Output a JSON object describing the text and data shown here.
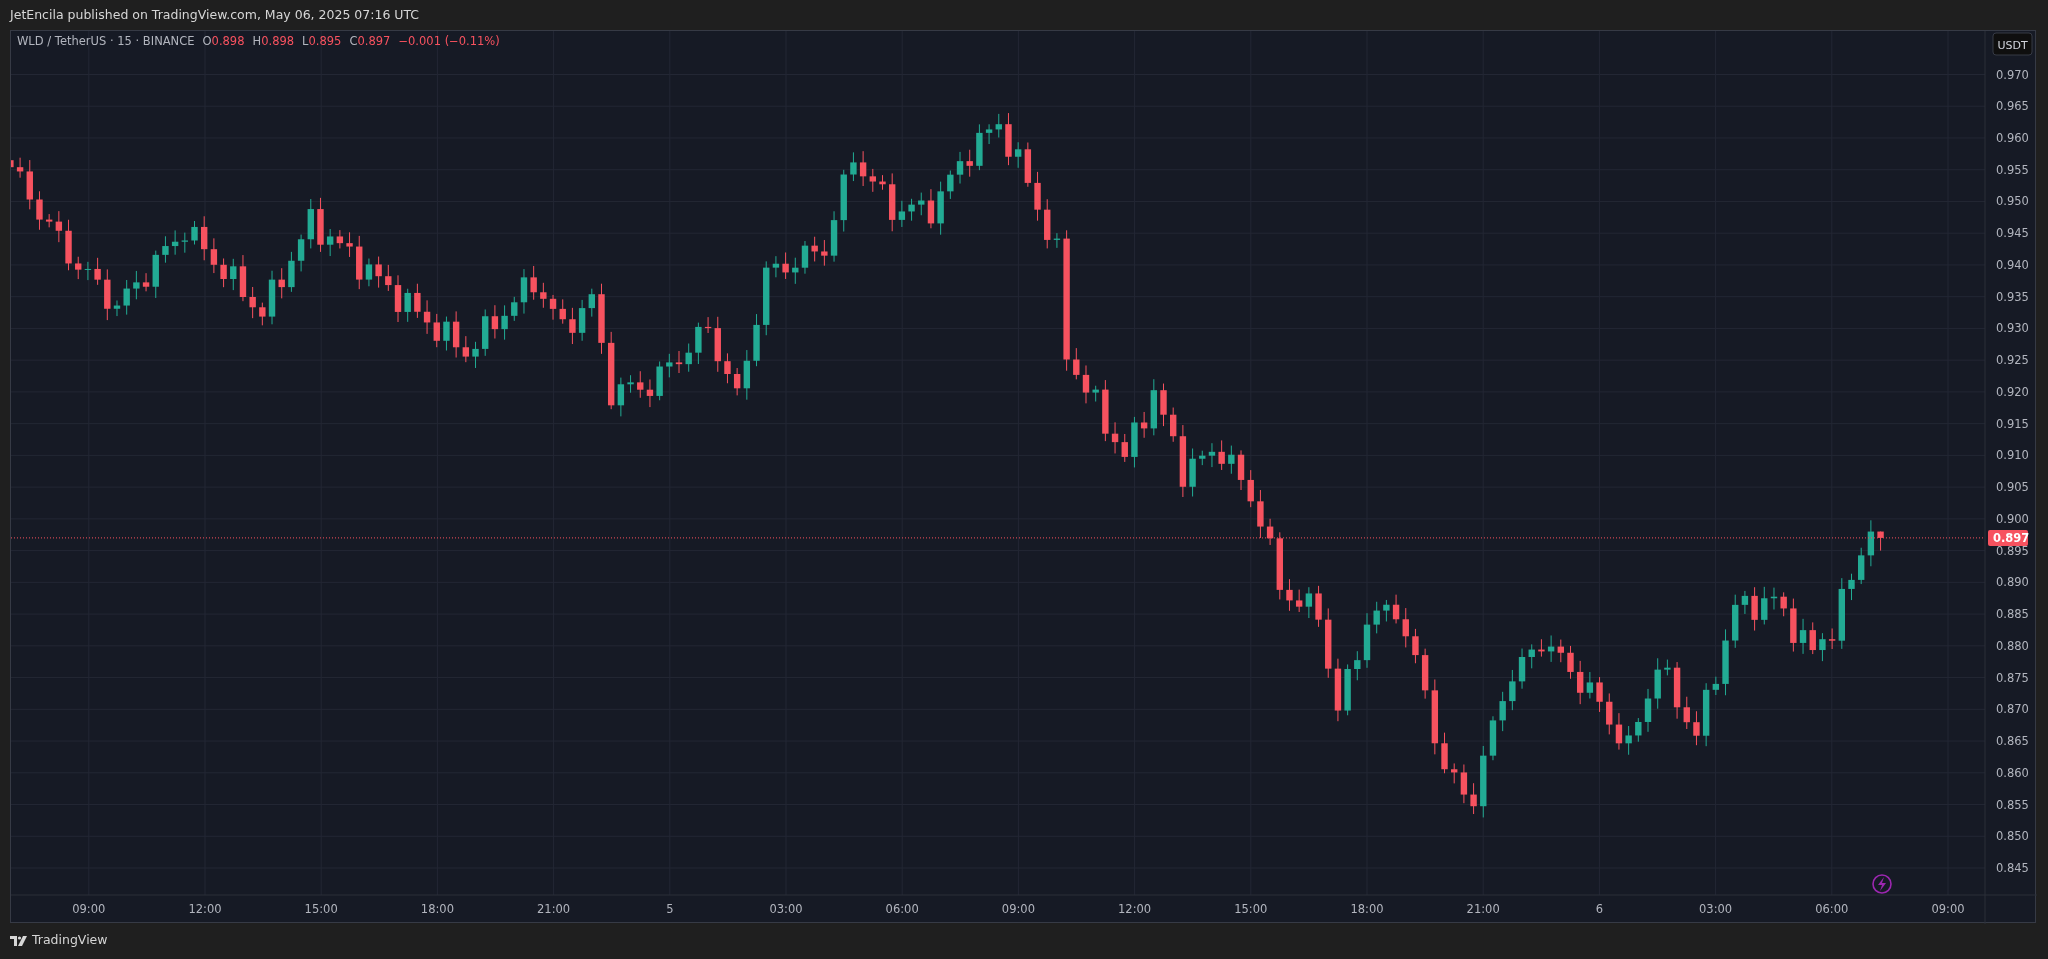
{
  "publish_note": "JetEncila published on TradingView.com, May 06, 2025 07:16 UTC",
  "legend": {
    "symbol": "WLD / TetherUS · 15 · BINANCE",
    "falling": true,
    "fields": [
      {
        "letter": "O",
        "value": "0.898"
      },
      {
        "letter": "H",
        "value": "0.898"
      },
      {
        "letter": "L",
        "value": "0.895"
      },
      {
        "letter": "C",
        "value": "0.897"
      }
    ],
    "change": "−0.001 (−0.11%)"
  },
  "price_axis": {
    "currency": "USDT",
    "ticks": [
      "0.970",
      "0.965",
      "0.960",
      "0.955",
      "0.950",
      "0.945",
      "0.940",
      "0.935",
      "0.930",
      "0.925",
      "0.920",
      "0.915",
      "0.910",
      "0.905",
      "0.900",
      "0.895",
      "0.890",
      "0.885",
      "0.880",
      "0.875",
      "0.870",
      "0.865",
      "0.860",
      "0.855",
      "0.850",
      "0.845"
    ],
    "last_price": "0.897"
  },
  "time_axis": {
    "labels": [
      "09:00",
      "12:00",
      "15:00",
      "18:00",
      "21:00",
      "5",
      "03:00",
      "06:00",
      "09:00",
      "12:00",
      "15:00",
      "18:00",
      "21:00",
      "6",
      "03:00",
      "06:00",
      "09:00"
    ]
  },
  "footer": {
    "brand": "TradingView"
  }
}
